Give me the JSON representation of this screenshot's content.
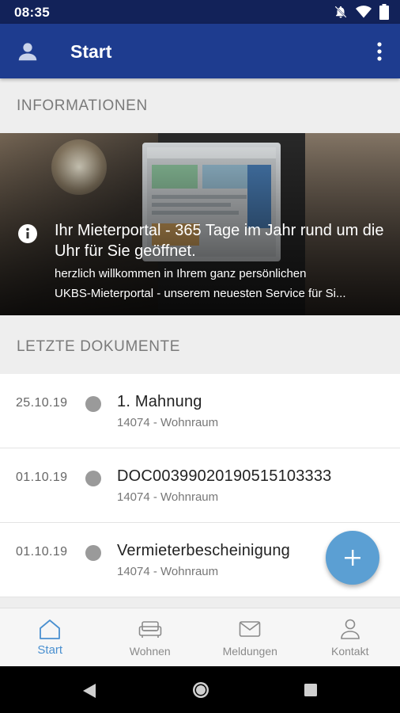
{
  "status_bar": {
    "time": "08:35"
  },
  "app_bar": {
    "title": "Start"
  },
  "sections": {
    "info_header": "INFORMATIONEN",
    "docs_header": "LETZTE DOKUMENTE"
  },
  "banner": {
    "headline": "Ihr Mieterportal - 365 Tage im Jahr rund um die Uhr für Sie geöffnet.",
    "desc_line1": "herzlich willkommen in Ihrem ganz persönlichen",
    "desc_line2": "UKBS-Mieterportal - unserem neuesten Service für Si..."
  },
  "documents": [
    {
      "date": "25.10.19",
      "name": "1. Mahnung",
      "sub": "14074 - Wohnraum"
    },
    {
      "date": "01.10.19",
      "name": "DOC00399020190515103333",
      "sub": "14074 - Wohnraum"
    },
    {
      "date": "01.10.19",
      "name": "Vermieterbescheinigung",
      "sub": "14074 - Wohnraum"
    }
  ],
  "bottom_nav": [
    {
      "label": "Start",
      "icon": "home-icon",
      "active": true
    },
    {
      "label": "Wohnen",
      "icon": "sofa-icon",
      "active": false
    },
    {
      "label": "Meldungen",
      "icon": "mail-icon",
      "active": false
    },
    {
      "label": "Kontakt",
      "icon": "person-icon",
      "active": false
    }
  ],
  "colors": {
    "app_bar": "#1e3c8f",
    "status_bar": "#122259",
    "fab": "#5b9fd3",
    "active_nav": "#4a90d0"
  }
}
